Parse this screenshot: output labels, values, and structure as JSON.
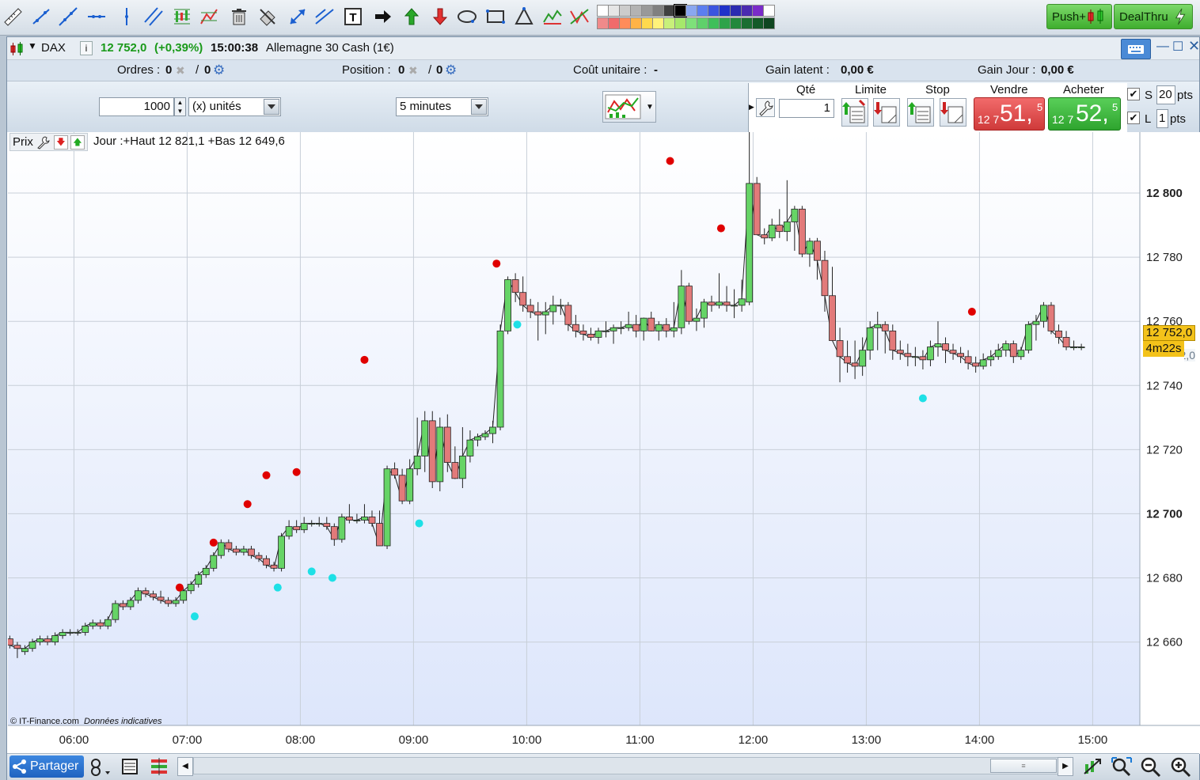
{
  "toolbar": {
    "tools": [
      "ruler-icon",
      "segment-icon",
      "line-icon",
      "horizontal-line-icon",
      "vertical-line-icon",
      "parallel-channel-icon",
      "fibonacci-icon",
      "gann-icon",
      "trash-icon",
      "eraser-icon",
      "arrow-diagonal-icon",
      "extended-line-icon",
      "text-icon",
      "arrow-right-icon",
      "arrow-up-icon",
      "arrow-down-icon",
      "ellipse-icon",
      "rectangle-icon",
      "triangle-icon",
      "zigzag-icon",
      "pattern-icon"
    ],
    "swatches_top": [
      "#ffffff",
      "#e6e6e6",
      "#cccccc",
      "#b3b3b3",
      "#999999",
      "#808080",
      "#404040",
      "#000000",
      "#8aa7f0",
      "#5b7ef0",
      "#3b55e0",
      "#1f31c9",
      "#2b2bb0",
      "#4b2bb0",
      "#7a2bc9",
      "#ffffff"
    ],
    "swatches_bottom": [
      "#f08a8a",
      "#f06b6b",
      "#ff8c5a",
      "#ffb347",
      "#ffd94d",
      "#fff27a",
      "#c8f07a",
      "#a6e86b",
      "#7ee07a",
      "#5fd06b",
      "#3fbf5a",
      "#2ea34a",
      "#23883c",
      "#1b6e31",
      "#145a28",
      "#0f4620"
    ],
    "push_label": "Push+",
    "dealthru_label": "DealThru"
  },
  "title": {
    "symbol": "DAX",
    "price": "12 752,0",
    "change": "(+0,39%)",
    "time": "15:00:38",
    "instrument": "Allemagne 30 Cash (1€)"
  },
  "info": {
    "orders_label": "Ordres :",
    "orders_value": "0",
    "orders_sep": "/",
    "orders_value2": "0",
    "position_label": "Position :",
    "position_value": "0",
    "position_sep": "/",
    "position_value2": "0",
    "unit_cost_label": "Coût unitaire :",
    "unit_cost_value": "-",
    "latent_label": "Gain latent :",
    "latent_value": "0,00 €",
    "day_gain_label": "Gain Jour :",
    "day_gain_value": "0,00 €"
  },
  "controls": {
    "quantity": "1000",
    "unit": "(x) unités",
    "timeframe": "5 minutes",
    "qty_label": "Qté",
    "qty_value": "1",
    "limit_label": "Limite",
    "stop_label": "Stop",
    "sell_label": "Vendre",
    "buy_label": "Acheter",
    "sell_prefix": "12 7",
    "sell_big": "51,",
    "sell_small": "5",
    "buy_prefix": "12 7",
    "buy_big": "52,",
    "buy_small": "5",
    "s_label": "S",
    "s_value": "20",
    "l_label": "L",
    "l_value": "1",
    "pts": "pts",
    "colors": {
      "sell": "#e04a4a",
      "buy": "#3cb83c"
    }
  },
  "chart_data": {
    "type": "candlestick",
    "legend_prefix": "Prix",
    "day_info": "Jour :+Haut 12 821,1 +Bas 12 649,6",
    "footer_copyright": "© IT-Finance.com",
    "footer_note": "Données indicatives",
    "ylim": [
      12634,
      12819
    ],
    "yticks": [
      {
        "v": 12800,
        "label": "12 800",
        "bold": true
      },
      {
        "v": 12780,
        "label": "12 780",
        "bold": false
      },
      {
        "v": 12760,
        "label": "12 760",
        "bold": false
      },
      {
        "v": 12740,
        "label": "12 740",
        "bold": false
      },
      {
        "v": 12720,
        "label": "12 720",
        "bold": false
      },
      {
        "v": 12700,
        "label": "12 700",
        "bold": true
      },
      {
        "v": 12680,
        "label": "12 680",
        "bold": false
      },
      {
        "v": 12660,
        "label": "12 660",
        "bold": false
      }
    ],
    "xlim_minutes": [
      325,
      925
    ],
    "xticks": [
      {
        "m": 360,
        "label": "06:00"
      },
      {
        "m": 420,
        "label": "07:00"
      },
      {
        "m": 480,
        "label": "08:00"
      },
      {
        "m": 540,
        "label": "09:00"
      },
      {
        "m": 600,
        "label": "10:00"
      },
      {
        "m": 660,
        "label": "11:00"
      },
      {
        "m": 720,
        "label": "12:00"
      },
      {
        "m": 780,
        "label": "13:00"
      },
      {
        "m": 840,
        "label": "14:00"
      },
      {
        "m": 900,
        "label": "15:00"
      }
    ],
    "current_price": "12 752,0",
    "countdown": "4m22s",
    "bid_label": "12 752,0",
    "colors": {
      "up": "#66d466",
      "down": "#e27a7a",
      "resistance_dot": "#e00000",
      "support_dot": "#1ee0e6"
    },
    "candles": [
      [
        326,
        12661,
        12662,
        12658,
        12659
      ],
      [
        330,
        12659,
        12660,
        12655,
        12658
      ],
      [
        334,
        12657,
        12659,
        12656,
        12658
      ],
      [
        338,
        12658,
        12661,
        12657,
        12660
      ],
      [
        342,
        12660,
        12662,
        12659,
        12661
      ],
      [
        346,
        12661,
        12662,
        12659,
        12660
      ],
      [
        350,
        12660,
        12663,
        12659,
        12662
      ],
      [
        354,
        12662,
        12664,
        12661,
        12663
      ],
      [
        358,
        12663,
        12664,
        12662,
        12663
      ],
      [
        362,
        12663,
        12664,
        12662,
        12663
      ],
      [
        366,
        12663,
        12666,
        12662,
        12665
      ],
      [
        370,
        12665,
        12667,
        12664,
        12666
      ],
      [
        374,
        12666,
        12667,
        12664,
        12665
      ],
      [
        378,
        12665,
        12668,
        12664,
        12667
      ],
      [
        382,
        12667,
        12673,
        12666,
        12672
      ],
      [
        386,
        12672,
        12673,
        12670,
        12671
      ],
      [
        390,
        12671,
        12674,
        12670,
        12673
      ],
      [
        394,
        12673,
        12677,
        12672,
        12676
      ],
      [
        398,
        12676,
        12677,
        12674,
        12675
      ],
      [
        402,
        12675,
        12676,
        12673,
        12674
      ],
      [
        406,
        12674,
        12676,
        12672,
        12673
      ],
      [
        410,
        12673,
        12674,
        12671,
        12672
      ],
      [
        414,
        12672,
        12674,
        12671,
        12673
      ],
      [
        418,
        12673,
        12677,
        12672,
        12676
      ],
      [
        422,
        12676,
        12679,
        12675,
        12678
      ],
      [
        426,
        12678,
        12682,
        12677,
        12681
      ],
      [
        430,
        12681,
        12684,
        12680,
        12683
      ],
      [
        434,
        12683,
        12688,
        12682,
        12687
      ],
      [
        438,
        12687,
        12692,
        12686,
        12691
      ],
      [
        442,
        12691,
        12692,
        12688,
        12689
      ],
      [
        446,
        12689,
        12690,
        12687,
        12688
      ],
      [
        450,
        12688,
        12690,
        12687,
        12689
      ],
      [
        454,
        12689,
        12690,
        12686,
        12687
      ],
      [
        458,
        12687,
        12688,
        12685,
        12686
      ],
      [
        462,
        12686,
        12687,
        12683,
        12684
      ],
      [
        466,
        12684,
        12685,
        12682,
        12683
      ],
      [
        470,
        12683,
        12694,
        12682,
        12693
      ],
      [
        474,
        12693,
        12698,
        12692,
        12696
      ],
      [
        478,
        12696,
        12698,
        12694,
        12695
      ],
      [
        482,
        12695,
        12699,
        12694,
        12697
      ],
      [
        486,
        12697,
        12698,
        12696,
        12697
      ],
      [
        490,
        12697,
        12699,
        12696,
        12697
      ],
      [
        494,
        12697,
        12699,
        12695,
        12696
      ],
      [
        498,
        12696,
        12697,
        12690,
        12692
      ],
      [
        502,
        12692,
        12700,
        12691,
        12699
      ],
      [
        506,
        12699,
        12703,
        12697,
        12698
      ],
      [
        510,
        12698,
        12700,
        12697,
        12698
      ],
      [
        514,
        12698,
        12703,
        12697,
        12699
      ],
      [
        518,
        12699,
        12701,
        12696,
        12697
      ],
      [
        522,
        12697,
        12701,
        12690,
        12690
      ],
      [
        526,
        12690,
        12715,
        12689,
        12714
      ],
      [
        530,
        12714,
        12716,
        12711,
        12712
      ],
      [
        534,
        12712,
        12714,
        12703,
        12704
      ],
      [
        538,
        12704,
        12717,
        12703,
        12714
      ],
      [
        542,
        12714,
        12730,
        12712,
        12718
      ],
      [
        546,
        12718,
        12732,
        12713,
        12729
      ],
      [
        550,
        12729,
        12732,
        12708,
        12710
      ],
      [
        554,
        12710,
        12730,
        12707,
        12727
      ],
      [
        558,
        12727,
        12731,
        12713,
        12716
      ],
      [
        562,
        12716,
        12721,
        12711,
        12711
      ],
      [
        566,
        12711,
        12727,
        12708,
        12718
      ],
      [
        570,
        12718,
        12726,
        12716,
        12723
      ],
      [
        574,
        12723,
        12725,
        12721,
        12724
      ],
      [
        578,
        12724,
        12726,
        12723,
        12725
      ],
      [
        582,
        12725,
        12729,
        12722,
        12727
      ],
      [
        586,
        12727,
        12759,
        12726,
        12757
      ],
      [
        590,
        12757,
        12774,
        12756,
        12773
      ],
      [
        594,
        12773,
        12775,
        12766,
        12769
      ],
      [
        598,
        12769,
        12774,
        12763,
        12765
      ],
      [
        602,
        12765,
        12767,
        12761,
        12763
      ],
      [
        606,
        12763,
        12766,
        12754,
        12762
      ],
      [
        610,
        12762,
        12766,
        12756,
        12763
      ],
      [
        614,
        12763,
        12768,
        12759,
        12765
      ],
      [
        618,
        12765,
        12767,
        12762,
        12765
      ],
      [
        622,
        12765,
        12766,
        12757,
        12759
      ],
      [
        626,
        12759,
        12762,
        12755,
        12757
      ],
      [
        630,
        12757,
        12759,
        12754,
        12756
      ],
      [
        634,
        12756,
        12758,
        12754,
        12755
      ],
      [
        638,
        12755,
        12758,
        12753,
        12757
      ],
      [
        642,
        12757,
        12760,
        12755,
        12757
      ],
      [
        646,
        12757,
        12759,
        12753,
        12758
      ],
      [
        650,
        12758,
        12760,
        12756,
        12758
      ],
      [
        654,
        12758,
        12763,
        12757,
        12759
      ],
      [
        658,
        12759,
        12762,
        12755,
        12757
      ],
      [
        662,
        12757,
        12760,
        12754,
        12761
      ],
      [
        666,
        12761,
        12763,
        12757,
        12757
      ],
      [
        670,
        12757,
        12760,
        12754,
        12759
      ],
      [
        674,
        12759,
        12761,
        12755,
        12757
      ],
      [
        678,
        12757,
        12766,
        12755,
        12758
      ],
      [
        682,
        12758,
        12776,
        12756,
        12771
      ],
      [
        686,
        12771,
        12772,
        12759,
        12760
      ],
      [
        690,
        12760,
        12764,
        12757,
        12761
      ],
      [
        694,
        12761,
        12767,
        12758,
        12766
      ],
      [
        698,
        12766,
        12768,
        12763,
        12765
      ],
      [
        702,
        12765,
        12775,
        12764,
        12766
      ],
      [
        706,
        12766,
        12771,
        12763,
        12765
      ],
      [
        710,
        12765,
        12770,
        12761,
        12765
      ],
      [
        714,
        12765,
        12773,
        12763,
        12767
      ],
      [
        718,
        12766,
        12821,
        12765,
        12803
      ],
      [
        722,
        12803,
        12805,
        12787,
        12787
      ],
      [
        726,
        12787,
        12789,
        12784,
        12786
      ],
      [
        730,
        12786,
        12792,
        12785,
        12790
      ],
      [
        734,
        12790,
        12795,
        12786,
        12788
      ],
      [
        738,
        12788,
        12804,
        12785,
        12791
      ],
      [
        742,
        12791,
        12796,
        12782,
        12795
      ],
      [
        746,
        12795,
        12796,
        12780,
        12781
      ],
      [
        750,
        12781,
        12786,
        12777,
        12785
      ],
      [
        754,
        12785,
        12786,
        12773,
        12779
      ],
      [
        758,
        12779,
        12782,
        12763,
        12768
      ],
      [
        762,
        12768,
        12777,
        12760,
        12754
      ],
      [
        766,
        12754,
        12758,
        12741,
        12749
      ],
      [
        770,
        12749,
        12754,
        12744,
        12747
      ],
      [
        774,
        12747,
        12754,
        12742,
        12746
      ],
      [
        778,
        12746,
        12755,
        12743,
        12751
      ],
      [
        782,
        12751,
        12760,
        12748,
        12758
      ],
      [
        786,
        12758,
        12763,
        12751,
        12759
      ],
      [
        790,
        12759,
        12760,
        12750,
        12757
      ],
      [
        794,
        12757,
        12759,
        12748,
        12751
      ],
      [
        798,
        12751,
        12754,
        12748,
        12750
      ],
      [
        802,
        12750,
        12753,
        12746,
        12749
      ],
      [
        806,
        12749,
        12752,
        12746,
        12749
      ],
      [
        810,
        12749,
        12751,
        12745,
        12748
      ],
      [
        814,
        12748,
        12754,
        12746,
        12752
      ],
      [
        818,
        12752,
        12760,
        12749,
        12753
      ],
      [
        822,
        12753,
        12755,
        12747,
        12751
      ],
      [
        826,
        12751,
        12753,
        12748,
        12750
      ],
      [
        830,
        12750,
        12752,
        12747,
        12749
      ],
      [
        834,
        12749,
        12751,
        12745,
        12747
      ],
      [
        838,
        12747,
        12749,
        12744,
        12746
      ],
      [
        842,
        12746,
        12750,
        12745,
        12748
      ],
      [
        846,
        12748,
        12751,
        12746,
        12749
      ],
      [
        850,
        12749,
        12753,
        12748,
        12751
      ],
      [
        854,
        12751,
        12754,
        12749,
        12753
      ],
      [
        858,
        12753,
        12754,
        12747,
        12749
      ],
      [
        862,
        12749,
        12752,
        12748,
        12751
      ],
      [
        866,
        12751,
        12760,
        12750,
        12759
      ],
      [
        870,
        12759,
        12762,
        12754,
        12760
      ],
      [
        874,
        12760,
        12766,
        12758,
        12765
      ],
      [
        878,
        12765,
        12766,
        12756,
        12757
      ],
      [
        882,
        12757,
        12759,
        12753,
        12755
      ],
      [
        886,
        12755,
        12757,
        12751,
        12752
      ],
      [
        890,
        12752,
        12754,
        12751,
        12752
      ],
      [
        894,
        12752,
        12753,
        12751,
        12752
      ]
    ],
    "dots_resistance": [
      [
        416,
        12677
      ],
      [
        434,
        12691
      ],
      [
        452,
        12703
      ],
      [
        462,
        12712
      ],
      [
        478,
        12713
      ],
      [
        514,
        12748
      ],
      [
        584,
        12778
      ],
      [
        676,
        12810
      ],
      [
        703,
        12789
      ],
      [
        836,
        12763
      ]
    ],
    "dots_support": [
      [
        424,
        12668
      ],
      [
        468,
        12677
      ],
      [
        486,
        12682
      ],
      [
        497,
        12680
      ],
      [
        543,
        12697
      ],
      [
        595,
        12759
      ],
      [
        810,
        12736
      ]
    ]
  },
  "bottom": {
    "share_label": "Partager"
  }
}
